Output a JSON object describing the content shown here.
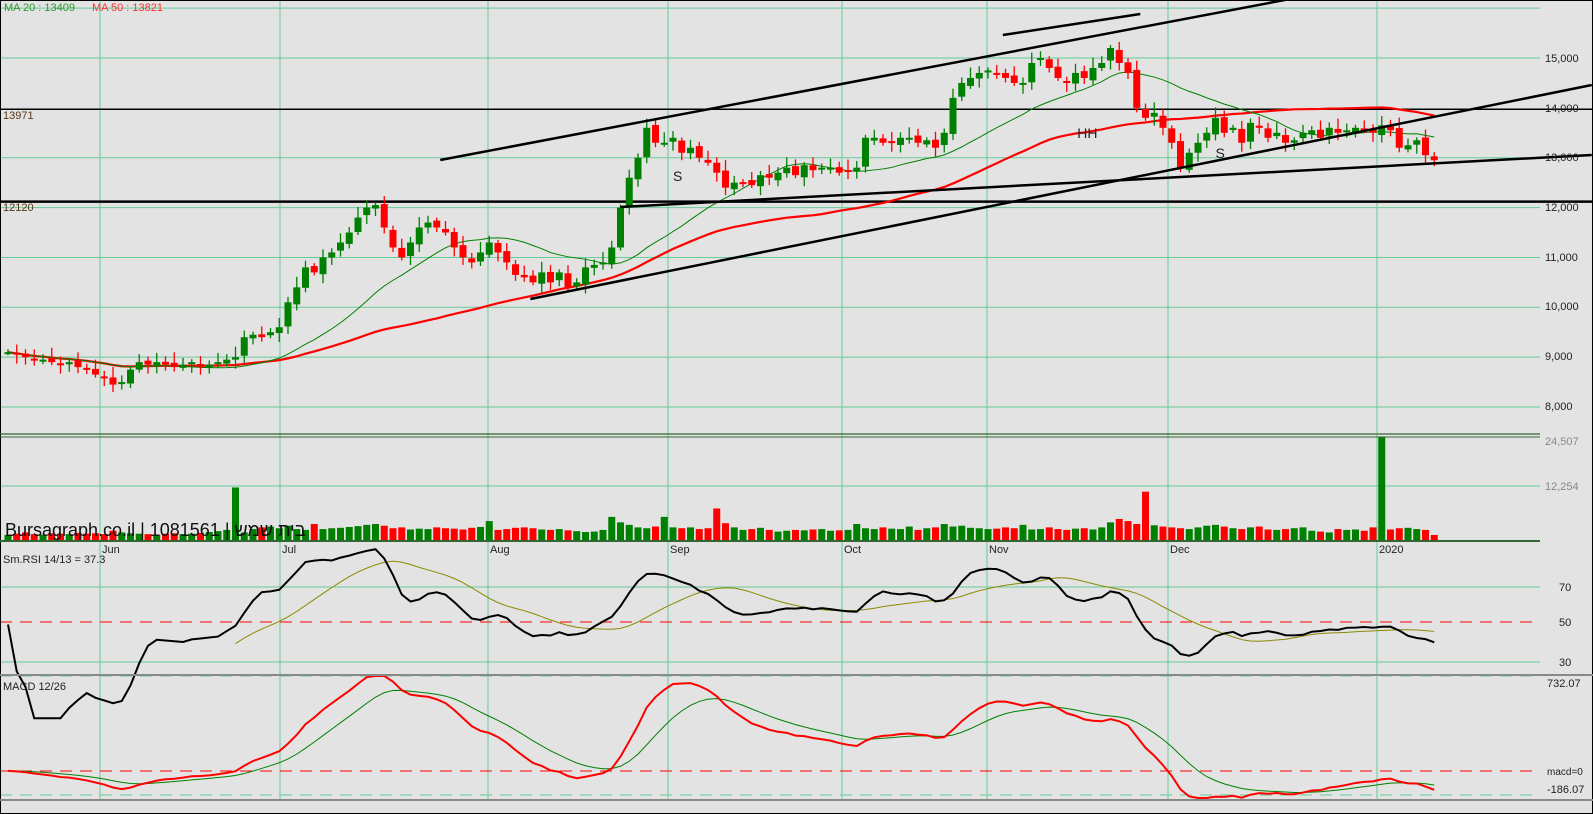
{
  "header": {
    "ma20_label": "MA 20 : 13409",
    "ma50_label": "MA 50 : 13821",
    "level_high_label": "13971",
    "level_low_label": "12120",
    "brand": "Bursagraph.co.il | 1081561 | בית שמש",
    "rsi_label": "Sm.RSI 14/13 = 37.3",
    "macd_label": "MACD 12/26"
  },
  "colors": {
    "background": "#e3e3e3",
    "grid": "#66cc99",
    "up": "#008000",
    "down": "#ff0000",
    "ma20": "#008000",
    "ma50": "#ff0000",
    "rsi": "#000000",
    "rsi_signal": "#8a8a00",
    "macd": "#ff0000",
    "macd_signal": "#008000"
  },
  "months": [
    "Jun",
    "Jul",
    "Aug",
    "Sep",
    "Oct",
    "Nov",
    "Dec",
    "2020"
  ],
  "price_axis": [
    "15,000",
    "14,000",
    "13,000",
    "12,000",
    "11,000",
    "10,000",
    "9,000",
    "8,000"
  ],
  "volume_axis": [
    "24,507",
    "12,254"
  ],
  "rsi_axis": [
    "70",
    "50",
    "30"
  ],
  "macd_axis": {
    "top": "732.07",
    "zero": "macd=0",
    "bottom": "-186.07"
  },
  "chart_data": {
    "type": "candlestick",
    "title": "1081561 בית שמש",
    "ylim": [
      7500,
      16200
    ],
    "levels": [
      13971,
      12120
    ],
    "close": [
      9100,
      9050,
      9000,
      8950,
      8950,
      8900,
      8850,
      8900,
      8800,
      8750,
      8650,
      8600,
      8450,
      8500,
      8750,
      8900,
      8850,
      8900,
      8850,
      8800,
      8850,
      8900,
      8800,
      8850,
      8900,
      8950,
      9000,
      9400,
      9450,
      9400,
      9500,
      9600,
      10100,
      10400,
      10800,
      10700,
      11000,
      11100,
      11300,
      11500,
      11800,
      12000,
      12050,
      11600,
      11200,
      11000,
      11300,
      11600,
      11700,
      11600,
      11500,
      11200,
      11000,
      10900,
      11100,
      11300,
      11100,
      10900,
      10650,
      10600,
      10500,
      10700,
      10500,
      10700,
      10400,
      10500,
      10800,
      10850,
      10900,
      11200,
      12000,
      12600,
      13000,
      13600,
      13300,
      13300,
      13400,
      13100,
      13200,
      13000,
      12900,
      12700,
      12400,
      12500,
      12500,
      12450,
      12650,
      12600,
      12700,
      12800,
      12650,
      12850,
      12750,
      12800,
      12800,
      12700,
      12750,
      12800,
      13400,
      13400,
      13300,
      13300,
      13400,
      13400,
      13300,
      13350,
      13200,
      13500,
      14200,
      14500,
      14600,
      14700,
      14750,
      14700,
      14600,
      14500,
      14500,
      14900,
      15000,
      14800,
      14600,
      14500,
      14700,
      14600,
      14800,
      14900,
      15200,
      14900,
      14700,
      14000,
      13800,
      13900,
      13600,
      13300,
      12800,
      13100,
      13300,
      13500,
      13800,
      13500,
      13600,
      13300,
      13700,
      13600,
      13400,
      13500,
      13300,
      13350,
      13500,
      13550,
      13400,
      13600,
      13500,
      13550,
      13600,
      13550,
      13500,
      13650,
      13550,
      13200,
      13250,
      13350,
      13050,
      12950
    ],
    "volume": [
      1200,
      1500,
      1800,
      1400,
      1300,
      1600,
      1500,
      1400,
      1700,
      1500,
      1600,
      1400,
      2200,
      1800,
      1600,
      1500,
      1400,
      1300,
      1500,
      1600,
      1400,
      1500,
      1700,
      1900,
      2100,
      2400,
      12500,
      1800,
      2600,
      3000,
      3200,
      2800,
      3400,
      2600,
      2400,
      3800,
      2600,
      2800,
      2900,
      3100,
      3300,
      3600,
      3800,
      3400,
      2800,
      3000,
      2500,
      2700,
      2600,
      3000,
      2800,
      2700,
      2500,
      2900,
      3100,
      4500,
      2400,
      2600,
      2900,
      3000,
      2800,
      2500,
      2400,
      2600,
      2300,
      2100,
      1900,
      2000,
      2400,
      5500,
      4200,
      3600,
      3000,
      2800,
      3200,
      5500,
      3000,
      2800,
      3000,
      2600,
      2800,
      7500,
      4000,
      3000,
      2400,
      2600,
      2900,
      2400,
      2000,
      2200,
      2400,
      2300,
      2500,
      2600,
      2200,
      2300,
      2400,
      3800,
      2800,
      2600,
      3000,
      2700,
      2600,
      3200,
      2400,
      2800,
      3000,
      3800,
      3200,
      3400,
      2900,
      2800,
      2600,
      2700,
      3000,
      2800,
      3600,
      2500,
      2600,
      3000,
      2600,
      2400,
      2700,
      2800,
      2500,
      3000,
      4200,
      5000,
      4500,
      3800,
      11500,
      3500,
      3200,
      3000,
      2800,
      2600,
      3000,
      3400,
      3600,
      3200,
      2800,
      2600,
      3000,
      3200,
      2500,
      2400,
      2600,
      2800,
      3000,
      2200,
      2000,
      1800,
      2600,
      2400,
      2500,
      2200,
      3000,
      24507,
      2500,
      2800,
      2900,
      2600,
      2400,
      1200
    ],
    "volume_max": 24507,
    "rsi": {
      "period": 14,
      "signal": 13,
      "current": 37.3,
      "ylim": [
        24,
        98
      ]
    },
    "macd": {
      "fast": 12,
      "slow": 26,
      "signal": 9,
      "ylim": [
        -186.07,
        732.07
      ]
    },
    "trendlines": [
      {
        "from": [
          49.4,
          12954
        ],
        "to": [
          145.9,
          16163
        ]
      },
      {
        "from": [
          113.7,
          15461
        ],
        "to": [
          129.4,
          15882
        ]
      },
      {
        "from": [
          59.7,
          10167
        ],
        "to": [
          181,
          14458
        ]
      },
      {
        "from": [
          70,
          12012
        ],
        "to": [
          181,
          13055
        ]
      }
    ],
    "annotations": [
      {
        "text": "S",
        "at": [
          76,
          12530
        ]
      },
      {
        "text": "HH",
        "at": [
          122.2,
          13400
        ]
      },
      {
        "text": "S",
        "at": [
          138,
          12995
        ]
      }
    ]
  }
}
